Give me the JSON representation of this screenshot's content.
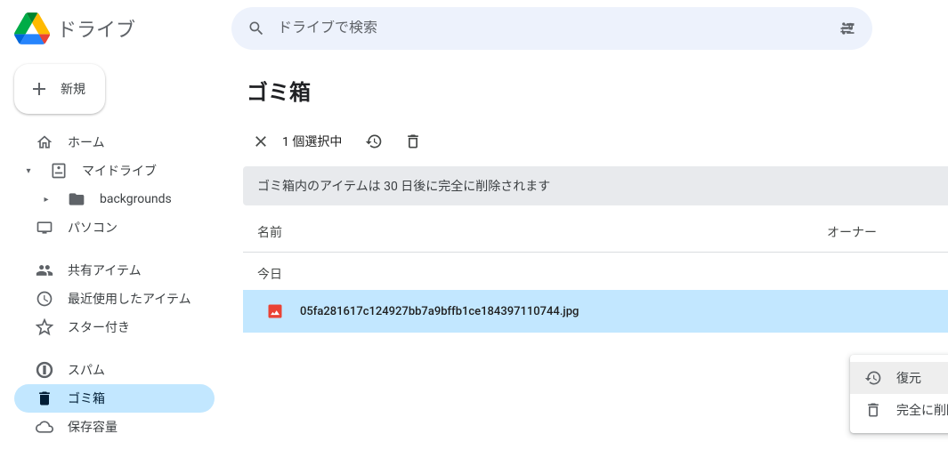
{
  "header": {
    "product_name": "ドライブ",
    "search_placeholder": "ドライブで検索"
  },
  "sidebar": {
    "new_label": "新規",
    "items": [
      {
        "label": "ホーム"
      },
      {
        "label": "マイドライブ"
      },
      {
        "label": "backgrounds"
      },
      {
        "label": "パソコン"
      },
      {
        "label": "共有アイテム"
      },
      {
        "label": "最近使用したアイテム"
      },
      {
        "label": "スター付き"
      },
      {
        "label": "スパム"
      },
      {
        "label": "ゴミ箱"
      },
      {
        "label": "保存容量"
      }
    ]
  },
  "main": {
    "title": "ゴミ箱",
    "selection_text": "1 個選択中",
    "banner": "ゴミ箱内のアイテムは 30 日後に完全に削除されます",
    "columns": {
      "name": "名前",
      "owner": "オーナー"
    },
    "section": "今日",
    "file": {
      "name": "05fa281617c124927bb7a9bffb1ce184397110744.jpg"
    }
  },
  "context_menu": {
    "restore": "復元",
    "delete_forever": "完全に削除"
  }
}
